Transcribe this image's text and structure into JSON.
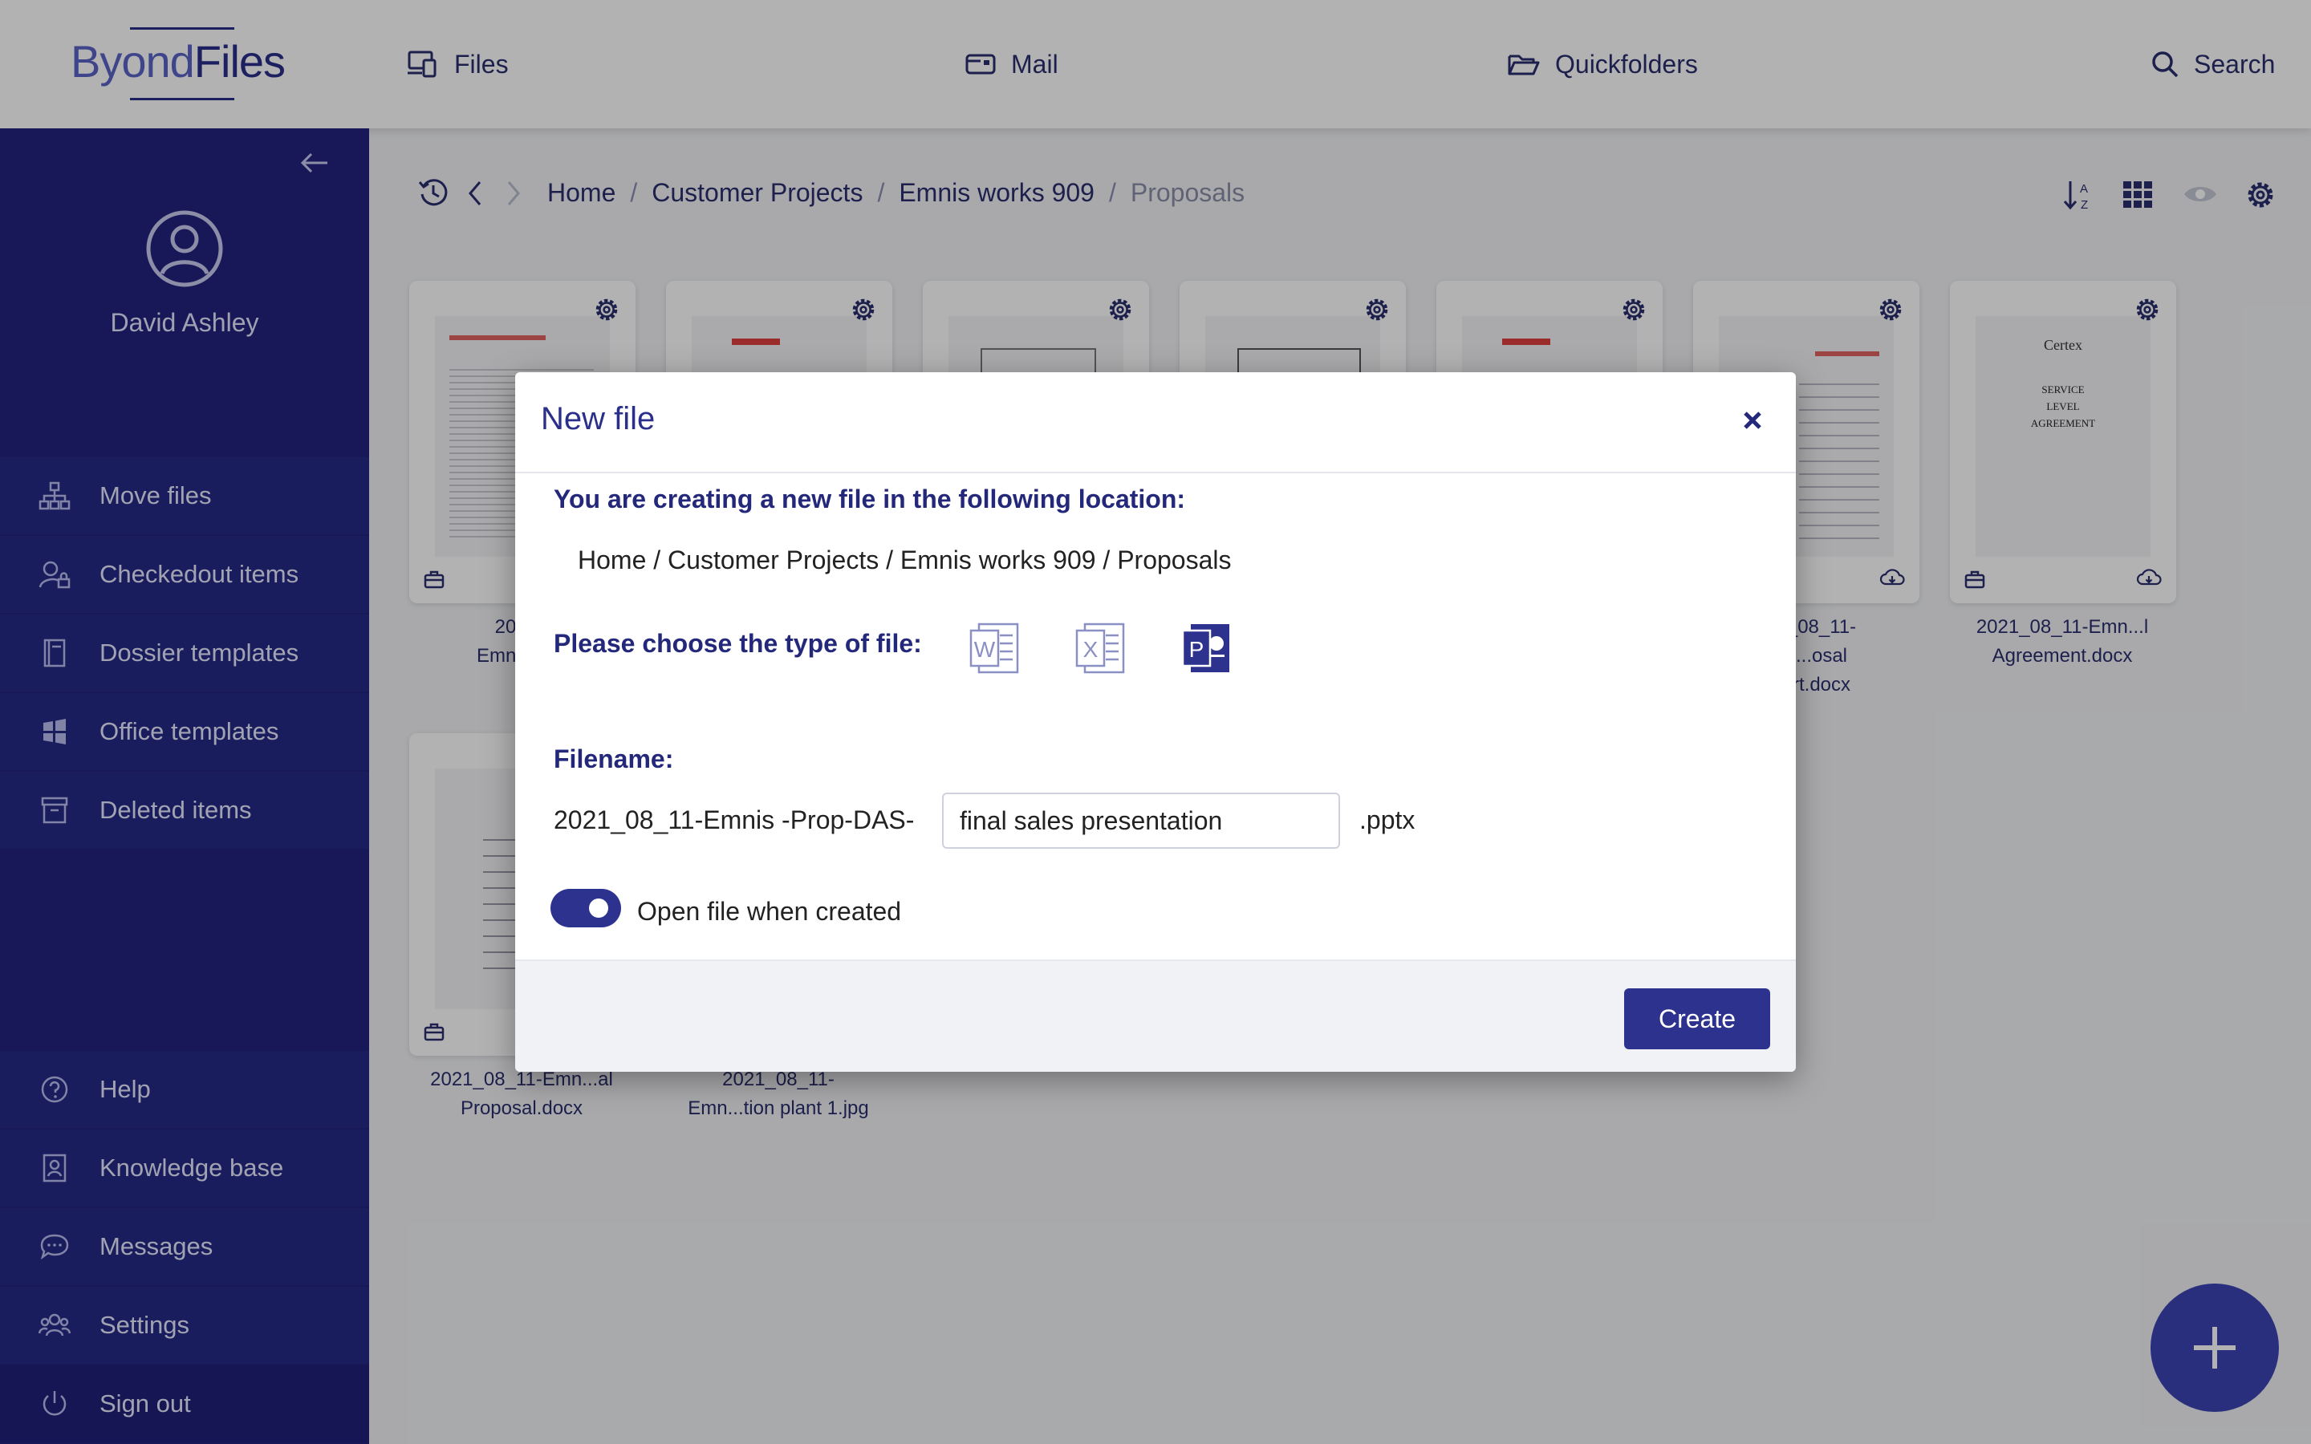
{
  "app": {
    "logo_left": "Byond",
    "logo_right": "Files"
  },
  "topnav": {
    "files": "Files",
    "mail": "Mail",
    "quickfolders": "Quickfolders",
    "search": "Search"
  },
  "sidebar": {
    "user": "David Ashley",
    "items": [
      {
        "label": "Move files",
        "icon": "sitemap-icon"
      },
      {
        "label": "Checkedout items",
        "icon": "user-lock-icon"
      },
      {
        "label": "Dossier templates",
        "icon": "book-icon"
      },
      {
        "label": "Office templates",
        "icon": "windows-icon"
      },
      {
        "label": "Deleted items",
        "icon": "archive-icon"
      }
    ],
    "bottom": [
      {
        "label": "Help",
        "icon": "help-icon"
      },
      {
        "label": "Knowledge base",
        "icon": "knowledge-icon"
      },
      {
        "label": "Messages",
        "icon": "chat-icon"
      },
      {
        "label": "Settings",
        "icon": "users-icon"
      },
      {
        "label": "Sign out",
        "icon": "power-icon"
      }
    ]
  },
  "breadcrumb": {
    "home": "Home",
    "p1": "Customer Projects",
    "p2": "Emnis works 909",
    "current": "Proposals"
  },
  "files": [
    {
      "line1": "2021_",
      "line2": "Emn...calc"
    },
    {
      "line1": "",
      "line2": ""
    },
    {
      "line1": "",
      "line2": ""
    },
    {
      "line1": "",
      "line2": ""
    },
    {
      "line1": "",
      "line2": ""
    },
    {
      "line1": "_08_11-",
      "line2": "...osal",
      "line3": "rt.docx"
    },
    {
      "line1": "2021_08_11-Emn...l",
      "line2": "Agreement.docx",
      "thumb_title": "Certex",
      "thumb_lines": [
        "SERVICE",
        "LEVEL",
        "AGREEMENT"
      ]
    },
    {
      "line1": "2021_08_11-Emn...al",
      "line2": "Proposal.docx"
    },
    {
      "line1": "2021_08_11-",
      "line2": "Emn...tion plant 1.jpg"
    }
  ],
  "modal": {
    "title": "New file",
    "location_label": "You are creating a new file in the following location:",
    "location": "Home / Customer Projects / Emnis works 909 / Proposals",
    "type_label": "Please choose the type of file:",
    "types": [
      {
        "name": "Word",
        "letter": "W"
      },
      {
        "name": "Excel",
        "letter": "X"
      },
      {
        "name": "PowerPoint",
        "letter": "P"
      }
    ],
    "filename_label": "Filename:",
    "prefix": "2021_08_11-Emnis -Prop-DAS-",
    "filename_value": "final sales presentation",
    "extension": ".pptx",
    "open_toggle_label": "Open file when created",
    "open_toggle_on": true,
    "create_label": "Create"
  }
}
